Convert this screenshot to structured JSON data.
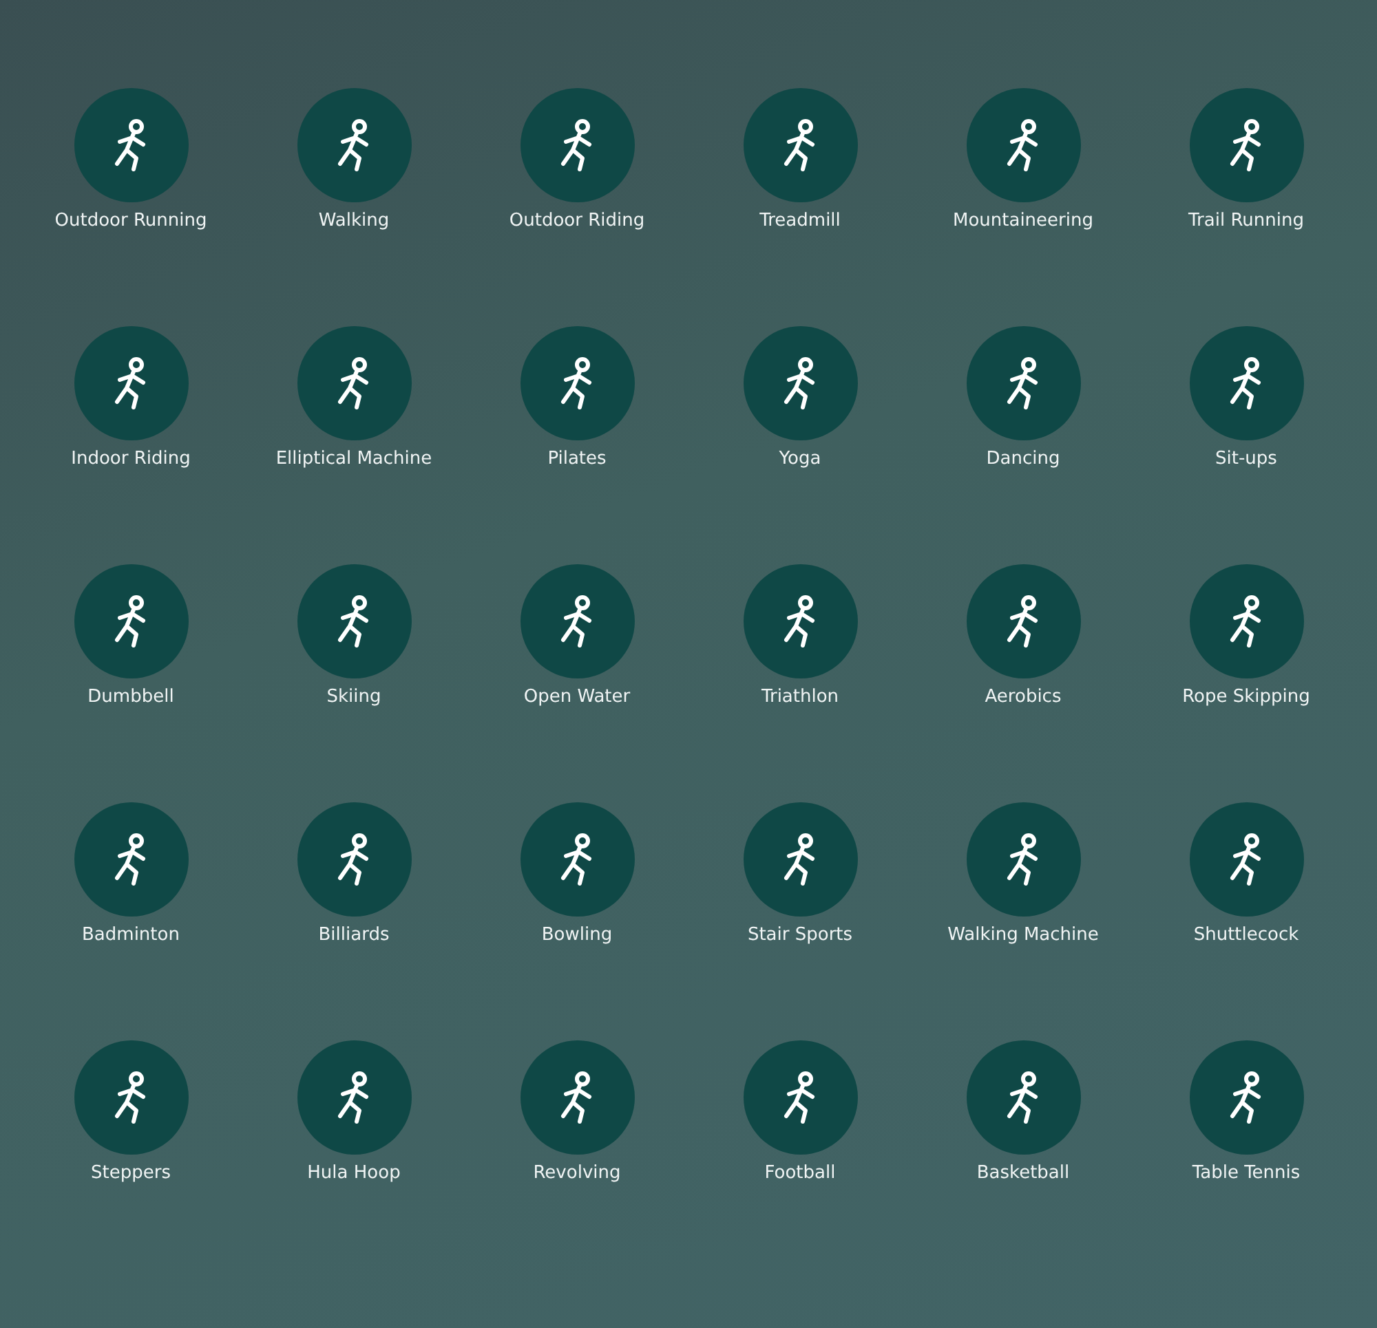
{
  "sports": [
    {
      "label": "Outdoor Running"
    },
    {
      "label": "Walking"
    },
    {
      "label": "Outdoor Riding"
    },
    {
      "label": "Treadmill"
    },
    {
      "label": "Mountaineering"
    },
    {
      "label": "Trail Running"
    },
    {
      "label": "Indoor Riding"
    },
    {
      "label": "Elliptical Machine"
    },
    {
      "label": "Pilates"
    },
    {
      "label": "Yoga"
    },
    {
      "label": "Dancing"
    },
    {
      "label": "Sit-ups"
    },
    {
      "label": "Dumbbell"
    },
    {
      "label": "Skiing"
    },
    {
      "label": "Open Water"
    },
    {
      "label": "Triathlon"
    },
    {
      "label": "Aerobics"
    },
    {
      "label": "Rope Skipping"
    },
    {
      "label": "Badminton"
    },
    {
      "label": "Billiards"
    },
    {
      "label": "Bowling"
    },
    {
      "label": "Stair Sports"
    },
    {
      "label": "Walking Machine"
    },
    {
      "label": "Shuttlecock"
    },
    {
      "label": "Steppers"
    },
    {
      "label": "Hula Hoop"
    },
    {
      "label": "Revolving"
    },
    {
      "label": "Football"
    },
    {
      "label": "Basketball"
    },
    {
      "label": "Table Tennis"
    }
  ]
}
